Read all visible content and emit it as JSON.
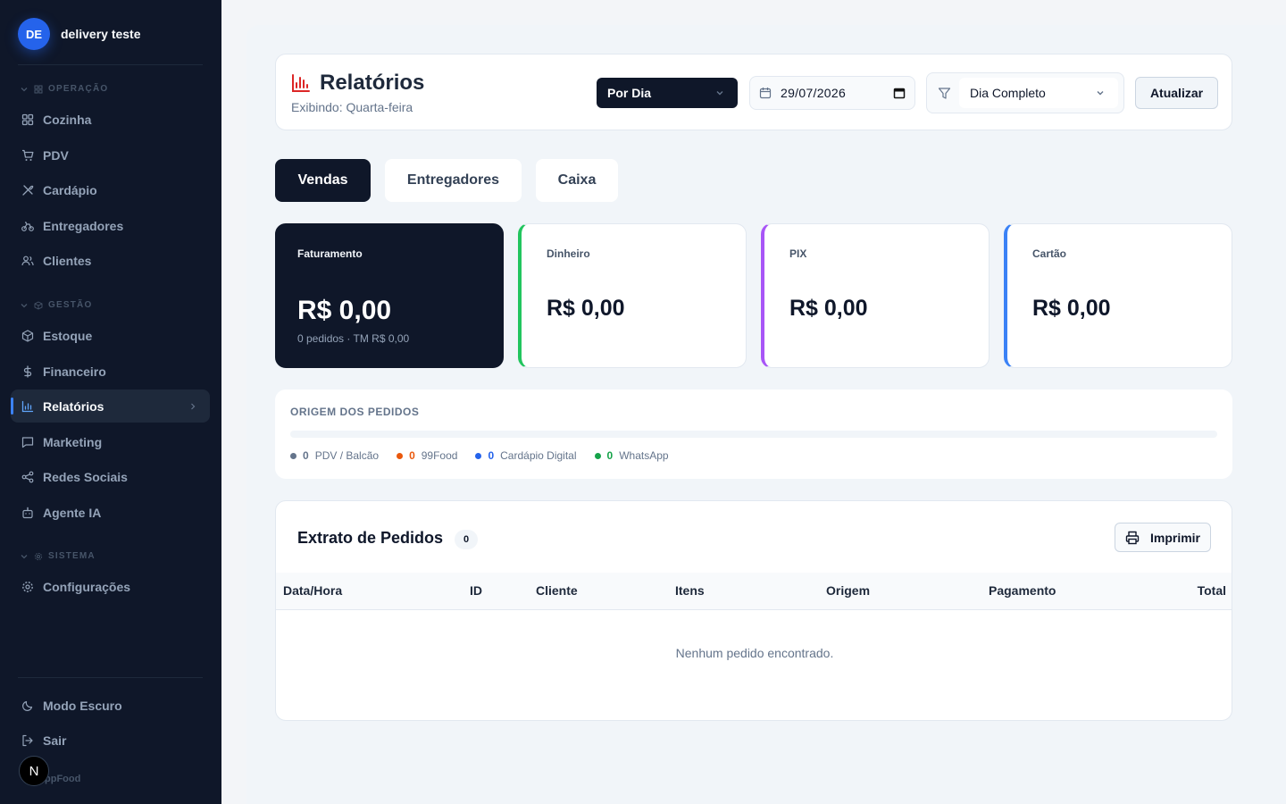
{
  "brand": {
    "initials": "DE",
    "name": "delivery teste"
  },
  "sidebar": {
    "sections": [
      {
        "title": "OPERAÇÃO"
      },
      {
        "title": "GESTÃO"
      },
      {
        "title": "SISTEMA"
      }
    ],
    "items": [
      {
        "label": "Cozinha",
        "icon": "grid-icon"
      },
      {
        "label": "PDV",
        "icon": "cart-icon"
      },
      {
        "label": "Cardápio",
        "icon": "utensils-icon"
      },
      {
        "label": "Entregadores",
        "icon": "bike-icon"
      },
      {
        "label": "Clientes",
        "icon": "users-icon"
      },
      {
        "label": "Estoque",
        "icon": "box-icon"
      },
      {
        "label": "Financeiro",
        "icon": "dollar-icon"
      },
      {
        "label": "Relatórios",
        "icon": "bar-chart-icon",
        "active": true
      },
      {
        "label": "Marketing",
        "icon": "message-icon"
      },
      {
        "label": "Redes Sociais",
        "icon": "share-icon"
      },
      {
        "label": "Agente IA",
        "icon": "bot-icon"
      },
      {
        "label": "Configurações",
        "icon": "gear-icon"
      }
    ],
    "bottom": [
      {
        "label": "Modo Escuro",
        "icon": "moon-icon"
      },
      {
        "label": "Sair",
        "icon": "logout-icon"
      }
    ],
    "badge": "N",
    "footer": "ppFood"
  },
  "header": {
    "title": "Relatórios",
    "subtitle": "Exibindo: Quarta-feira",
    "mode": "Por Dia",
    "date": "29/07/2026",
    "period": "Dia Completo",
    "update_label": "Atualizar"
  },
  "tabs": [
    {
      "label": "Vendas",
      "active": true
    },
    {
      "label": "Entregadores"
    },
    {
      "label": "Caixa"
    }
  ],
  "stats": {
    "faturamento": {
      "label": "Faturamento",
      "value": "R$ 0,00",
      "sub": "0 pedidos · TM R$ 0,00"
    },
    "dinheiro": {
      "label": "Dinheiro",
      "value": "R$ 0,00",
      "color": "#22c55e"
    },
    "pix": {
      "label": "PIX",
      "value": "R$ 0,00",
      "color": "#a855f7"
    },
    "cartao": {
      "label": "Cartão",
      "value": "R$ 0,00",
      "color": "#3b82f6"
    }
  },
  "origin": {
    "title": "ORIGEM DOS PEDIDOS",
    "sources": [
      {
        "count": "0",
        "label": "PDV / Balcão",
        "color": "#64748b"
      },
      {
        "count": "0",
        "label": "99Food",
        "color": "#ea580c"
      },
      {
        "count": "0",
        "label": "Cardápio Digital",
        "color": "#2563eb"
      },
      {
        "count": "0",
        "label": "WhatsApp",
        "color": "#16a34a"
      }
    ]
  },
  "extrato": {
    "title": "Extrato de Pedidos",
    "count": "0",
    "print_label": "Imprimir",
    "columns": [
      "Data/Hora",
      "ID",
      "Cliente",
      "Itens",
      "Origem",
      "Pagamento",
      "Total"
    ],
    "empty": "Nenhum pedido encontrado."
  }
}
